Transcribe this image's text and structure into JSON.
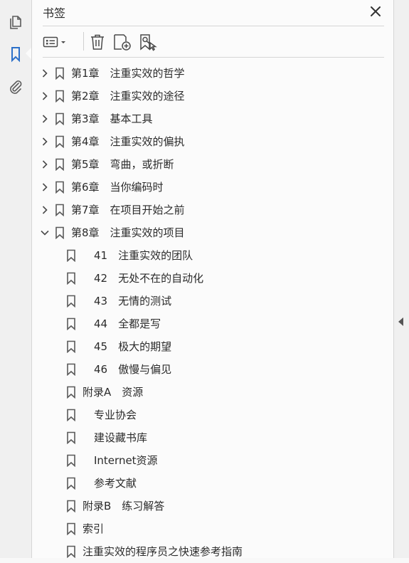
{
  "panel": {
    "title": "书签"
  },
  "icons": {
    "pages": "pages-icon",
    "bookmarks": "bookmark-icon",
    "attachments": "paperclip-icon",
    "close": "close-icon",
    "options": "options-menu-icon",
    "delete": "trash-icon",
    "new_bookmark": "new-bookmark-icon",
    "bookmark_from_selection": "bookmark-search-icon"
  },
  "bookmarks": [
    {
      "label": "第1章　注重实效的哲学",
      "level": 0,
      "expandable": true,
      "expanded": false
    },
    {
      "label": "第2章　注重实效的途径",
      "level": 0,
      "expandable": true,
      "expanded": false
    },
    {
      "label": "第3章　基本工具",
      "level": 0,
      "expandable": true,
      "expanded": false
    },
    {
      "label": "第4章　注重实效的偏执",
      "level": 0,
      "expandable": true,
      "expanded": false
    },
    {
      "label": "第5章　弯曲，或折断",
      "level": 0,
      "expandable": true,
      "expanded": false
    },
    {
      "label": "第6章　当你编码时",
      "level": 0,
      "expandable": true,
      "expanded": false
    },
    {
      "label": "第7章　在项目开始之前",
      "level": 0,
      "expandable": true,
      "expanded": false
    },
    {
      "label": "第8章　注重实效的项目",
      "level": 0,
      "expandable": true,
      "expanded": true
    },
    {
      "label": "41　注重实效的团队",
      "level": 2,
      "expandable": false
    },
    {
      "label": "42　无处不在的自动化",
      "level": 2,
      "expandable": false
    },
    {
      "label": "43　无情的测试",
      "level": 2,
      "expandable": false
    },
    {
      "label": "44　全都是写",
      "level": 2,
      "expandable": false
    },
    {
      "label": "45　极大的期望",
      "level": 2,
      "expandable": false
    },
    {
      "label": "46　傲慢与偏见",
      "level": 2,
      "expandable": false
    },
    {
      "label": "附录A　资源",
      "level": 1,
      "expandable": false
    },
    {
      "label": "专业协会",
      "level": 2,
      "expandable": false
    },
    {
      "label": "建设藏书库",
      "level": 2,
      "expandable": false
    },
    {
      "label": "Internet资源",
      "level": 2,
      "expandable": false
    },
    {
      "label": "参考文献",
      "level": 2,
      "expandable": false
    },
    {
      "label": "附录B　练习解答",
      "level": 1,
      "expandable": false
    },
    {
      "label": "索引",
      "level": 1,
      "expandable": false
    },
    {
      "label": "注重实效的程序员之快速参考指南",
      "level": 1,
      "expandable": false
    }
  ],
  "colors": {
    "icon": "#5a5a5a",
    "active_icon": "#2c70c9"
  }
}
